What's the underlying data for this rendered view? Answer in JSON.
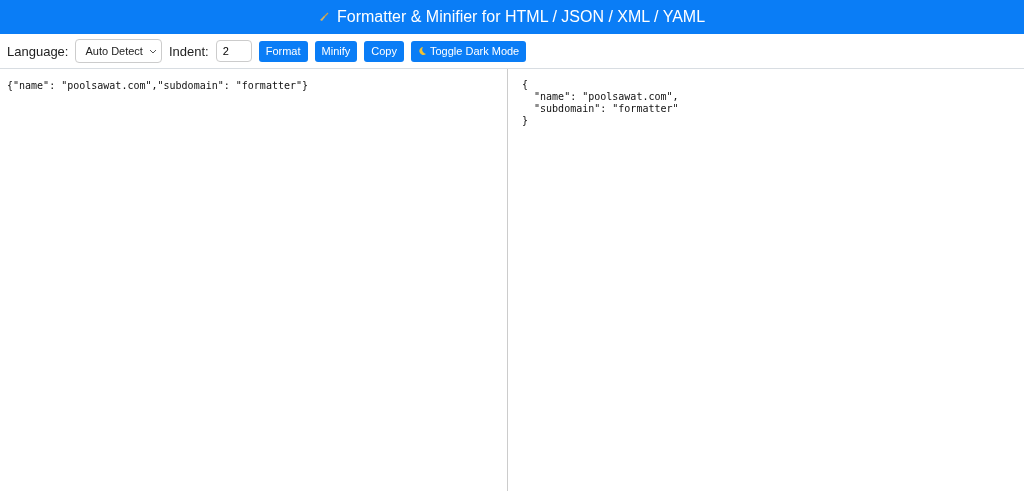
{
  "header": {
    "title": "Formatter & Minifier for HTML / JSON / XML / YAML"
  },
  "toolbar": {
    "language_label": "Language:",
    "language_value": "Auto Detect",
    "indent_label": "Indent:",
    "indent_value": "2",
    "buttons": [
      {
        "kind": "plain",
        "label": "Format"
      },
      {
        "kind": "plain",
        "label": "Minify"
      },
      {
        "kind": "plain",
        "label": "Copy"
      },
      {
        "kind": "moon",
        "label": "Toggle Dark Mode"
      }
    ]
  },
  "input": {
    "value": "{\"name\": \"poolsawat.com\",\"subdomain\": \"formatter\"}"
  },
  "output": {
    "text": "{\n  \"name\": \"poolsawat.com\",\n  \"subdomain\": \"formatter\"\n}"
  }
}
